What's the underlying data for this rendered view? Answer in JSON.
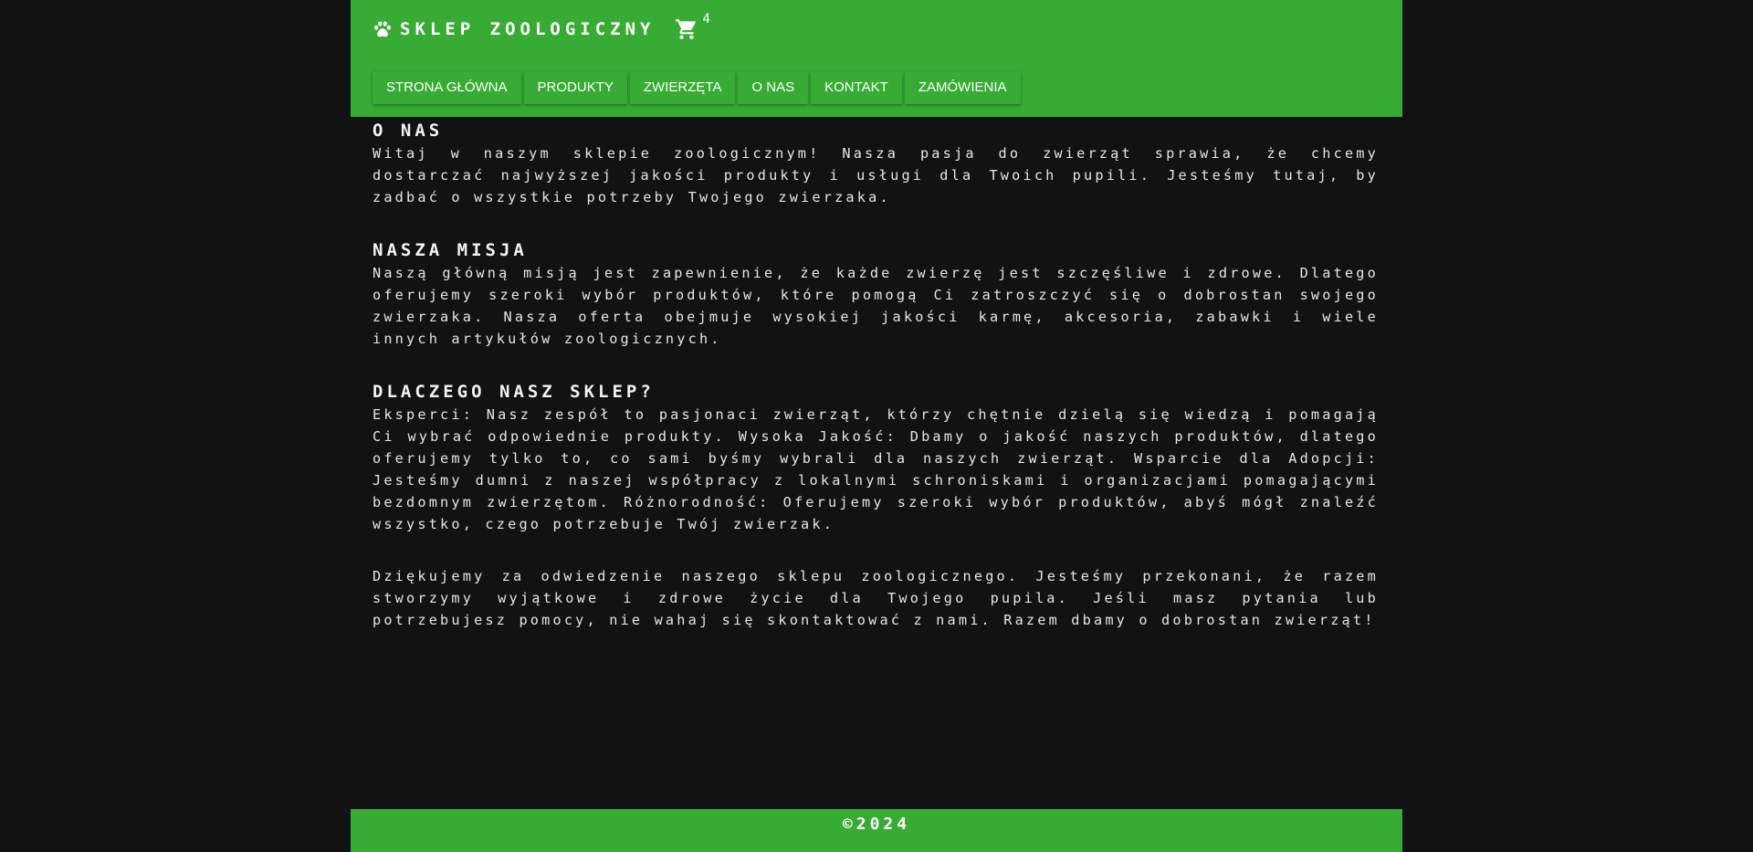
{
  "header": {
    "brand_icon": "paw-icon",
    "title": "SKLEP ZOOLOGICZNY",
    "cart_icon": "cart-icon",
    "cart_count": "4",
    "accent_color": "#37ab34"
  },
  "nav": {
    "items": [
      {
        "label": "STRONA GŁÓWNA"
      },
      {
        "label": "PRODUKTY"
      },
      {
        "label": "ZWIERZĘTA"
      },
      {
        "label": "O NAS"
      },
      {
        "label": "KONTAKT"
      },
      {
        "label": "ZAMÓWIENIA"
      }
    ]
  },
  "main": {
    "about": {
      "title": "O NAS",
      "text": "Witaj w naszym sklepie zoologicznym! Nasza pasja do zwierząt sprawia, że chcemy dostarczać najwyższej jakości produkty i usługi dla Twoich pupili. Jesteśmy tutaj, by zadbać o wszystkie potrzeby Twojego zwierzaka."
    },
    "mission": {
      "title": "NASZA MISJA",
      "text": "Naszą główną misją jest zapewnienie, że każde zwierzę jest szczęśliwe i zdrowe. Dlatego oferujemy szeroki wybór produktów, które pomogą Ci zatroszczyć się o dobrostan swojego zwierzaka. Nasza oferta obejmuje wysokiej jakości karmę, akcesoria, zabawki i wiele innych artykułów zoologicznych."
    },
    "why": {
      "title": "DLACZEGO NASZ SKLEP?",
      "text": "Eksperci: Nasz zespół to pasjonaci zwierząt, którzy chętnie dzielą się wiedzą i pomagają Ci wybrać odpowiednie produkty. Wysoka Jakość: Dbamy o jakość naszych produktów, dlatego oferujemy tylko to, co sami byśmy wybrali dla naszych zwierząt. Wsparcie dla Adopcji: Jesteśmy dumni z naszej współpracy z lokalnymi schroniskami i organizacjami pomagającymi bezdomnym zwierzętom. Różnorodność: Oferujemy szeroki wybór produktów, abyś mógł znaleźć wszystko, czego potrzebuje Twój zwierzak."
    },
    "thanks": {
      "text": "Dziękujemy za odwiedzenie naszego sklepu zoologicznego. Jesteśmy przekonani, że razem stworzymy wyjątkowe i zdrowe życie dla Twojego pupila. Jeśli masz pytania lub potrzebujesz pomocy, nie wahaj się skontaktować z nami. Razem dbamy o dobrostan zwierząt!"
    }
  },
  "footer": {
    "text": "©2024"
  }
}
